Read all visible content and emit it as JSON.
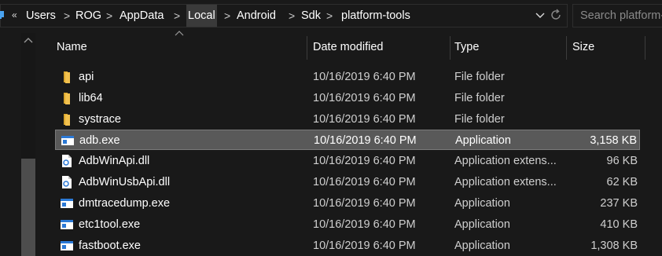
{
  "address_bar": {
    "overflow_label": "«",
    "crumbs": [
      "Users",
      "ROG",
      "AppData",
      "Local",
      "Android",
      "Sdk",
      "platform-tools"
    ],
    "separator": ">"
  },
  "search": {
    "placeholder": "Search platform-tools"
  },
  "columns": {
    "name": "Name",
    "date": "Date modified",
    "type": "Type",
    "size": "Size"
  },
  "files": [
    {
      "name": "api",
      "date": "10/16/2019 6:40 PM",
      "type": "File folder",
      "size": "",
      "icon": "folder-icon"
    },
    {
      "name": "lib64",
      "date": "10/16/2019 6:40 PM",
      "type": "File folder",
      "size": "",
      "icon": "folder-icon"
    },
    {
      "name": "systrace",
      "date": "10/16/2019 6:40 PM",
      "type": "File folder",
      "size": "",
      "icon": "folder-icon"
    },
    {
      "name": "adb.exe",
      "date": "10/16/2019 6:40 PM",
      "type": "Application",
      "size": "3,158 KB",
      "icon": "application-icon",
      "selected": true
    },
    {
      "name": "AdbWinApi.dll",
      "date": "10/16/2019 6:40 PM",
      "type": "Application extens...",
      "size": "96 KB",
      "icon": "dll-icon"
    },
    {
      "name": "AdbWinUsbApi.dll",
      "date": "10/16/2019 6:40 PM",
      "type": "Application extens...",
      "size": "62 KB",
      "icon": "dll-icon"
    },
    {
      "name": "dmtracedump.exe",
      "date": "10/16/2019 6:40 PM",
      "type": "Application",
      "size": "237 KB",
      "icon": "application-icon"
    },
    {
      "name": "etc1tool.exe",
      "date": "10/16/2019 6:40 PM",
      "type": "Application",
      "size": "410 KB",
      "icon": "application-icon"
    },
    {
      "name": "fastboot.exe",
      "date": "10/16/2019 6:40 PM",
      "type": "Application",
      "size": "1,308 KB",
      "icon": "application-icon"
    }
  ],
  "colors": {
    "background": "#191919",
    "selection": "#595959",
    "folder": "#f2c14e",
    "app_icon": "#2b79d6"
  }
}
